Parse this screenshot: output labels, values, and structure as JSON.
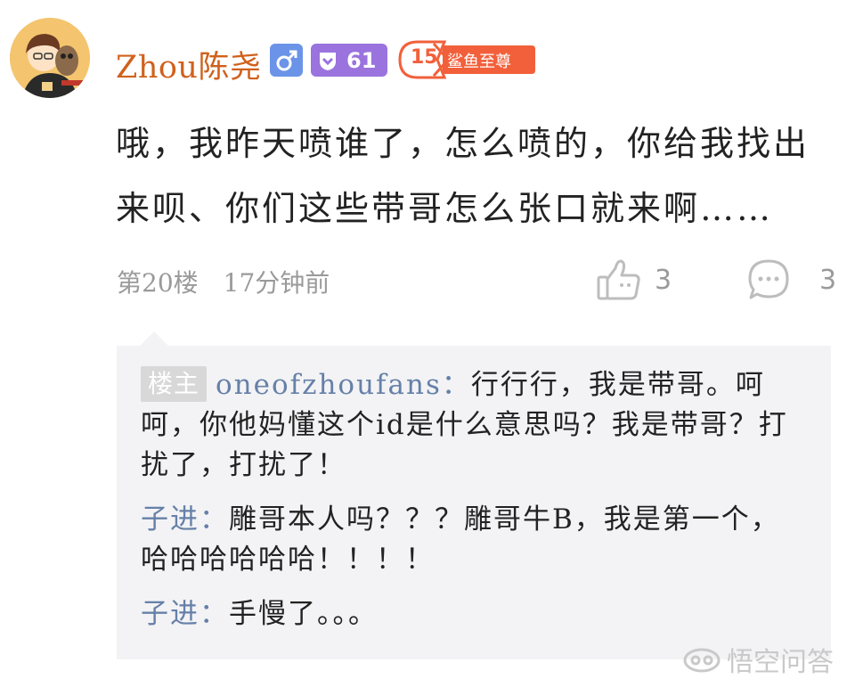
{
  "post": {
    "username": "Zhou陈尧",
    "level": "61",
    "fan_badge_level": "15",
    "fan_badge_text": "鲨鱼至尊",
    "content": "哦，我昨天喷谁了，怎么喷的，你给我找出来呗、你们这些带哥怎么张口就来啊……",
    "floor": "第20楼",
    "time": "17分钟前",
    "likes": "3",
    "comments": "3"
  },
  "replies": [
    {
      "op_badge": "楼主",
      "author": "oneofzhoufans：",
      "text": "行行行，我是带哥。呵呵，你他妈懂这个id是什么意思吗？我是带哥？打扰了，打扰了！"
    },
    {
      "author": "子进：",
      "text": "雕哥本人吗？？？雕哥牛B，我是第一个，哈哈哈哈哈哈！！！！"
    },
    {
      "author": "子进：",
      "text": "手慢了。。。"
    }
  ],
  "watermark": "悟空问答",
  "colors": {
    "username": "#d0611c",
    "gender_badge": "#6b94e8",
    "level_badge": "#9a73de",
    "fan_badge": "#f2603b",
    "reply_author": "#6680a8",
    "reply_bg": "#f3f3f5",
    "meta_gray": "#9a9a9a"
  },
  "icons": [
    "avatar",
    "male-icon",
    "level-icon",
    "fan-badge",
    "thumbs-up-icon",
    "comment-bubble-icon",
    "wukong-logo-icon"
  ]
}
